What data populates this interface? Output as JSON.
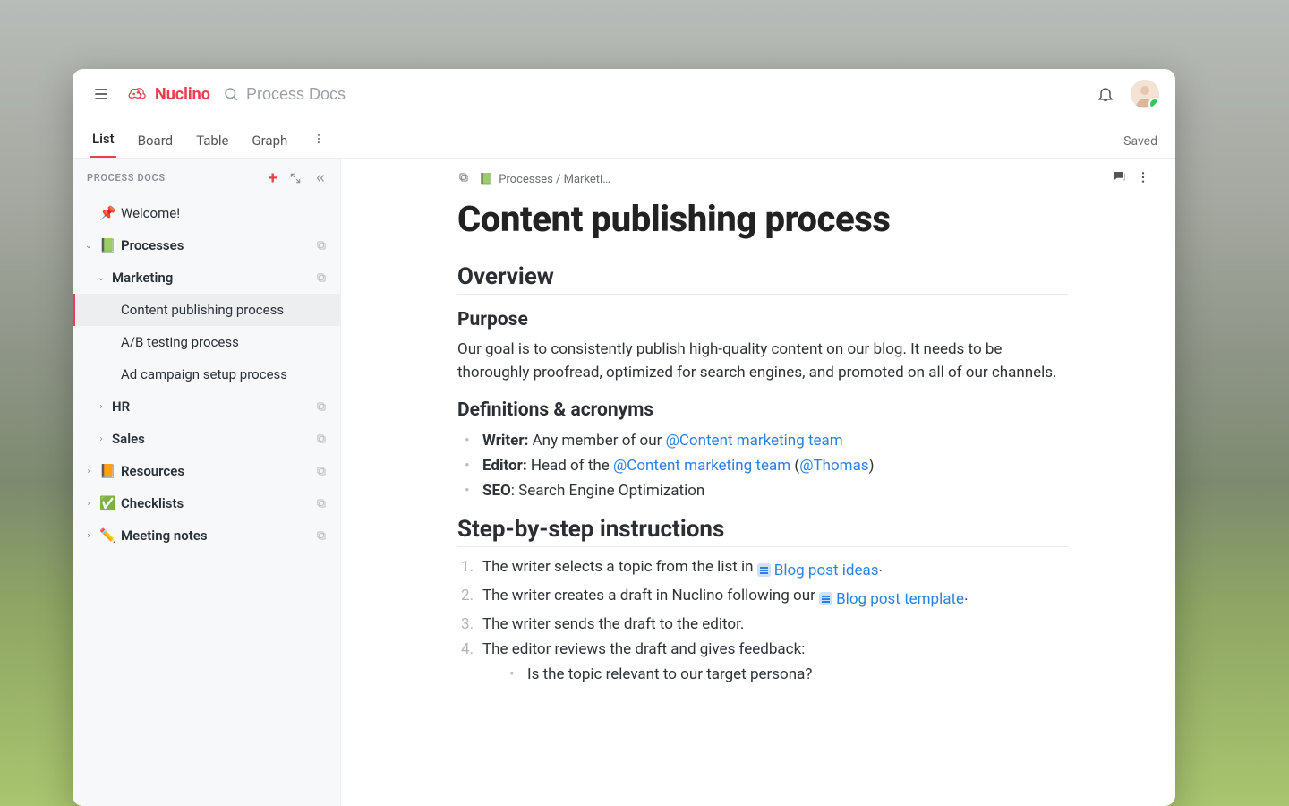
{
  "app_name": "Nuclino",
  "search_placeholder": "Process Docs",
  "tabs": {
    "list": "List",
    "board": "Board",
    "table": "Table",
    "graph": "Graph"
  },
  "save_status": "Saved",
  "sidebar": {
    "title": "PROCESS DOCS",
    "welcome": {
      "icon": "📌",
      "label": "Welcome!"
    },
    "processes": {
      "icon": "📗",
      "label": "Processes"
    },
    "marketing": {
      "label": "Marketing"
    },
    "marketing_children": {
      "content": "Content publishing process",
      "ab": "A/B testing process",
      "ad": "Ad campaign setup process"
    },
    "hr": {
      "label": "HR"
    },
    "sales": {
      "label": "Sales"
    },
    "resources": {
      "icon": "📙",
      "label": "Resources"
    },
    "checklists": {
      "icon": "✅",
      "label": "Checklists"
    },
    "meeting": {
      "icon": "✏️",
      "label": "Meeting notes"
    }
  },
  "crumb": {
    "icon": "📗",
    "text": "Processes / Marketi…"
  },
  "doc": {
    "title": "Content publishing process",
    "h_overview": "Overview",
    "h_purpose": "Purpose",
    "p_purpose": "Our goal is to consistently publish high-quality content on our blog. It needs to be thoroughly proofread, optimized for search engines, and promoted on all of our channels.",
    "h_defs": "Definitions & acronyms",
    "defs": {
      "writer_k": "Writer:",
      "writer_v": " Any member of our ",
      "writer_m": "@Content marketing team",
      "editor_k": "Editor:",
      "editor_v": " Head of the ",
      "editor_m1": "@Content marketing team",
      "editor_paren_open": " (",
      "editor_m2": "@Thomas",
      "editor_paren_close": ")",
      "seo_k": "SEO",
      "seo_v": ": Search Engine Optimization"
    },
    "h_steps": "Step-by-step instructions",
    "steps": {
      "s1a": "The writer selects a topic from the list in ",
      "s1link": "Blog post ideas",
      "s1b": ".",
      "s2a": "The writer creates a draft in Nuclino following our ",
      "s2link": "Blog post template",
      "s2b": ".",
      "s3": "The writer sends the draft to the editor.",
      "s4": "The editor reviews the draft and gives feedback:",
      "s4a": "Is the topic relevant to our target persona?"
    }
  }
}
